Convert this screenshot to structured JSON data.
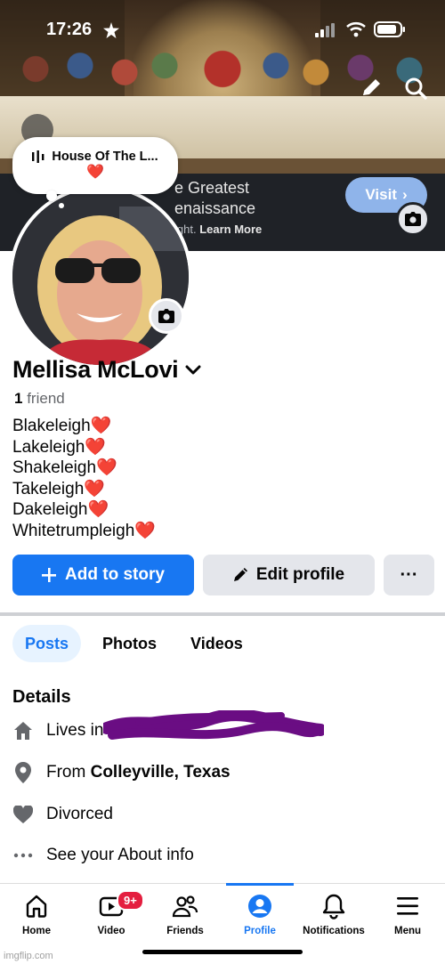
{
  "status_bar": {
    "time": "17:26",
    "icons": [
      "location-arrow-icon",
      "signal-icon",
      "wifi-icon",
      "battery-icon"
    ]
  },
  "cover": {
    "ad_line1": "e Greatest",
    "ad_line2": "enaissance",
    "ad_small_prefix": "ight.",
    "ad_small_link": "Learn More",
    "visit_label": "Visit"
  },
  "note": {
    "title": "House Of The L...",
    "emoji": "❤️"
  },
  "profile": {
    "name": "Mellisa McLovi",
    "friend_count": "1",
    "friend_label": "friend",
    "bio_lines": [
      "Blakeleigh",
      "Lakeleigh",
      "Shakeleigh",
      "Takeleigh",
      "Dakeleigh",
      "Whitetrumpleigh"
    ],
    "bio_heart": "❤️"
  },
  "actions": {
    "add_story": "Add to story",
    "edit_profile": "Edit profile",
    "more": "···"
  },
  "tabs": [
    "Posts",
    "Photos",
    "Videos"
  ],
  "details": {
    "title": "Details",
    "lives_in": "Lives in",
    "from_prefix": "From",
    "from_place": "Colleyville, Texas",
    "relationship": "Divorced",
    "about": "See your About info"
  },
  "bottom_nav": {
    "items": [
      "Home",
      "Video",
      "Friends",
      "Profile",
      "Notifications",
      "Menu"
    ],
    "video_badge": "9+",
    "active": "Profile"
  },
  "colors": {
    "accent": "#1877f2",
    "heart": "#e0242e",
    "badge": "#e41e3f",
    "scribble": "#6a0d83"
  },
  "watermark": "imgflip.com"
}
